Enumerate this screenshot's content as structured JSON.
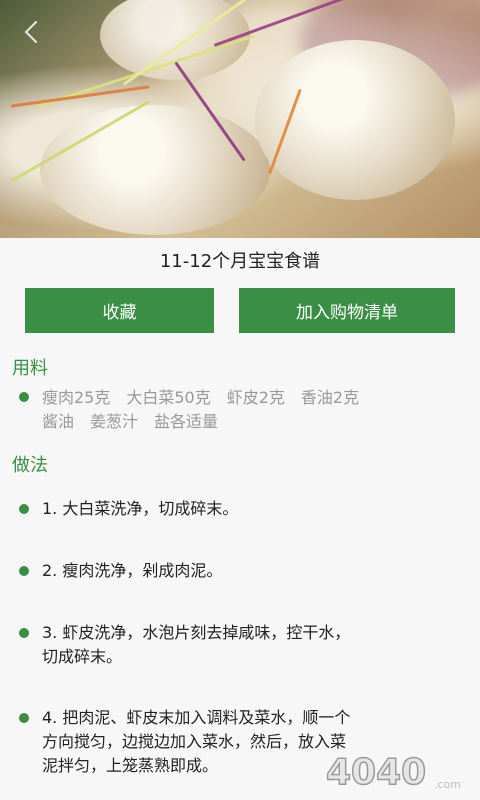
{
  "recipe": {
    "title": "11-12个月宝宝食谱",
    "buttons": {
      "favorite": "收藏",
      "add_to_list": "加入购物清单"
    }
  },
  "ingredients": {
    "heading": "用料",
    "line1": "瘦肉25克　大白菜50克　虾皮2克　香油2克",
    "line2": "酱油　姜葱汁　盐各适量"
  },
  "method": {
    "heading": "做法",
    "steps": [
      {
        "line1": "1. 大白菜洗净，切成碎末。"
      },
      {
        "line1": "2. 瘦肉洗净，剁成肉泥。"
      },
      {
        "line1": "3. 虾皮洗净，水泡片刻去掉咸味，控干水，",
        "line2": "切成碎末。"
      },
      {
        "line1": "4. 把肉泥、虾皮末加入调料及菜水，顺一个",
        "line2": "方向搅匀，边搅边加入菜水，然后，放入菜",
        "line3": "泥拌匀，上笼蒸熟即成。"
      }
    ]
  },
  "watermark": {
    "brand": "4040",
    "suffix": ".com"
  },
  "colors": {
    "accent": "#3a8f45",
    "muted_text": "#999999",
    "background": "#f7f7f7"
  },
  "icons": {
    "back": "chevron-left-icon",
    "bullet": "green-dot-icon"
  }
}
